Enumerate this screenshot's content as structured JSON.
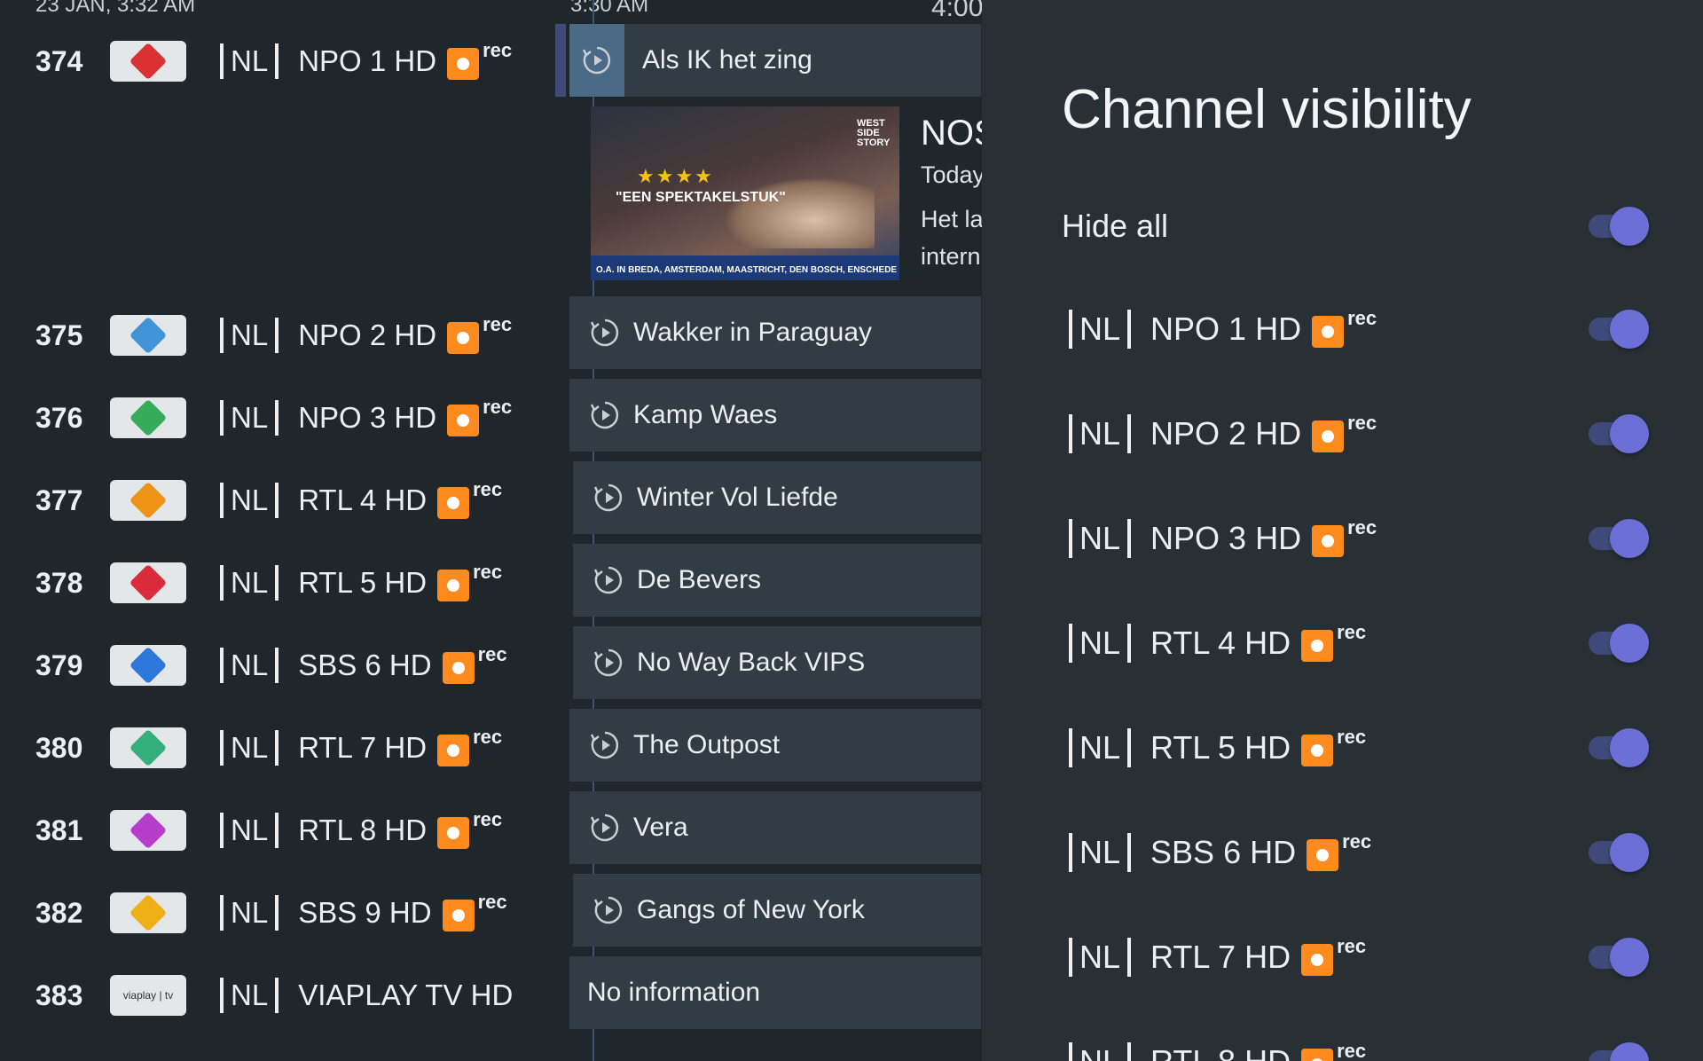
{
  "status": {
    "date_time": "23 JAN, 3:32 AM",
    "now_time": "3:30 AM",
    "next_time": "4:00"
  },
  "rec_label": "rec",
  "channels": [
    {
      "number": "374",
      "country": "NL",
      "name": "NPO 1 HD",
      "logo": "npo1-logo",
      "rec": true
    },
    {
      "number": "375",
      "country": "NL",
      "name": "NPO 2 HD",
      "logo": "npo2-logo",
      "rec": true
    },
    {
      "number": "376",
      "country": "NL",
      "name": "NPO 3 HD",
      "logo": "npo3-logo",
      "rec": true
    },
    {
      "number": "377",
      "country": "NL",
      "name": "RTL 4 HD",
      "logo": "rtl4-logo",
      "rec": true
    },
    {
      "number": "378",
      "country": "NL",
      "name": "RTL 5 HD",
      "logo": "rtl5-logo",
      "rec": true
    },
    {
      "number": "379",
      "country": "NL",
      "name": "SBS 6 HD",
      "logo": "sbs6-logo",
      "rec": true
    },
    {
      "number": "380",
      "country": "NL",
      "name": "RTL 7 HD",
      "logo": "rtl7-logo",
      "rec": true
    },
    {
      "number": "381",
      "country": "NL",
      "name": "RTL 8 HD",
      "logo": "rtl8-logo",
      "rec": true
    },
    {
      "number": "382",
      "country": "NL",
      "name": "SBS 9 HD",
      "logo": "sbs9-logo",
      "rec": true
    },
    {
      "number": "383",
      "country": "NL",
      "name": "VIAPLAY TV HD",
      "logo": "viaplay-logo",
      "logo_text": "viaplay | tv",
      "rec": false
    }
  ],
  "programs": [
    {
      "title": "Als IK het zing",
      "icon": "replay-icon"
    },
    {
      "title": "Wakker in Paraguay",
      "icon": "replay-icon"
    },
    {
      "title": "Kamp Waes",
      "icon": "replay-icon"
    },
    {
      "title": "Winter Vol Liefde",
      "icon": "replay-icon"
    },
    {
      "title": "De Bevers",
      "icon": "replay-icon"
    },
    {
      "title": "No Way Back VIPS",
      "icon": "replay-icon"
    },
    {
      "title": "The Outpost",
      "icon": "replay-icon"
    },
    {
      "title": "Vera",
      "icon": "replay-icon"
    },
    {
      "title": "Gangs of New York",
      "icon": "replay-icon"
    },
    {
      "title": "No information",
      "icon": ""
    }
  ],
  "detail": {
    "title": "NOS",
    "line1": "Today",
    "line2": "Het la",
    "line3": "intern",
    "poster": {
      "quote": "\"EEN SPEKTAKELSTUK\"",
      "stars": "★★★★",
      "strip": "O.A. IN BREDA, AMSTERDAM, MAASTRICHT, DEN BOSCH, ENSCHEDE & HEERLEN",
      "corner": "WEST SIDE STORY"
    }
  },
  "panel": {
    "title": "Channel visibility",
    "hide_all_label": "Hide all",
    "hide_all_on": true,
    "items": [
      {
        "country": "NL",
        "name": "NPO 1 HD",
        "rec": true,
        "on": true
      },
      {
        "country": "NL",
        "name": "NPO 2 HD",
        "rec": true,
        "on": true
      },
      {
        "country": "NL",
        "name": "NPO 3 HD",
        "rec": true,
        "on": true
      },
      {
        "country": "NL",
        "name": "RTL 4 HD",
        "rec": true,
        "on": true
      },
      {
        "country": "NL",
        "name": "RTL 5 HD",
        "rec": true,
        "on": true
      },
      {
        "country": "NL",
        "name": "SBS 6 HD",
        "rec": true,
        "on": true
      },
      {
        "country": "NL",
        "name": "RTL 7 HD",
        "rec": true,
        "on": true
      },
      {
        "country": "NL",
        "name": "RTL 8 HD",
        "rec": true,
        "on": true
      }
    ]
  },
  "colors": {
    "accent": "#6c6fd6",
    "rec": "#ff8a1e",
    "tile": "#323c45",
    "background": "#1f262c",
    "panel": "#283036"
  }
}
